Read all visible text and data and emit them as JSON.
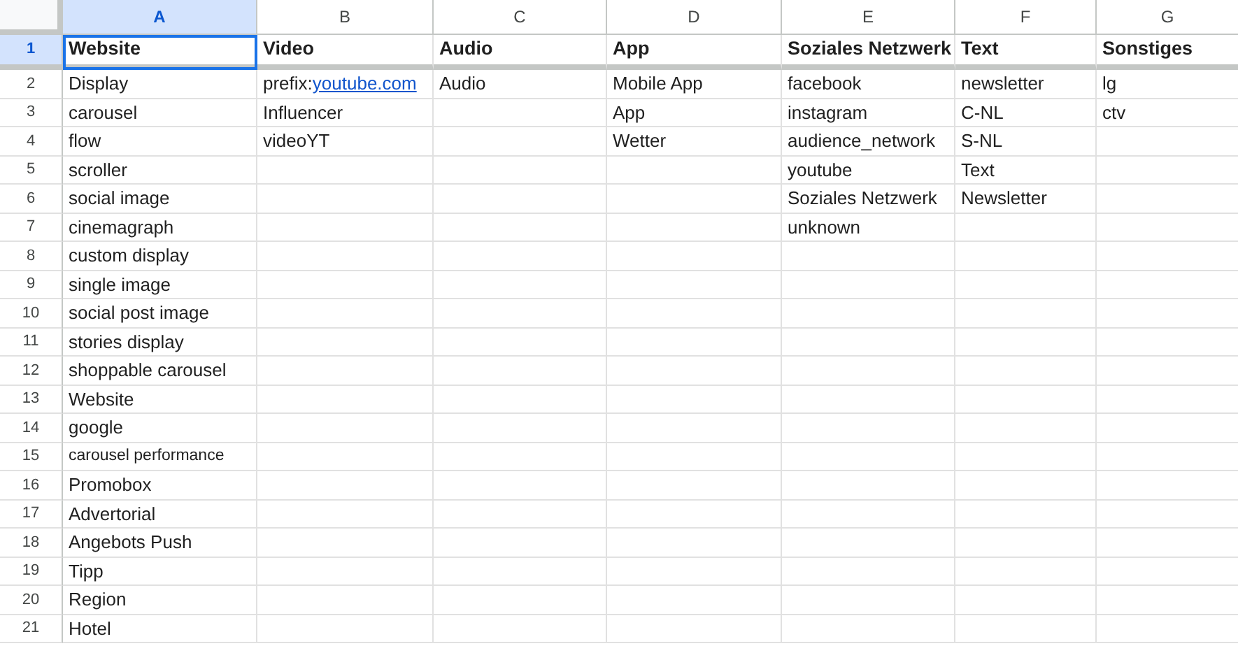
{
  "columns": [
    {
      "label": "A",
      "selected": true
    },
    {
      "label": "B",
      "selected": false
    },
    {
      "label": "C",
      "selected": false
    },
    {
      "label": "D",
      "selected": false
    },
    {
      "label": "E",
      "selected": false
    },
    {
      "label": "F",
      "selected": false
    },
    {
      "label": "G",
      "selected": false
    }
  ],
  "rows": [
    {
      "number": "1",
      "selected": true,
      "bold": true,
      "frozen": true,
      "cells": [
        "Website",
        "Video",
        "Audio",
        "App",
        "Soziales Netzwerk",
        "Text",
        "Sonstiges"
      ]
    },
    {
      "number": "2",
      "selected": false,
      "cells": [
        "Display",
        {
          "text": "prefix:",
          "link": "youtube.com"
        },
        "Audio",
        "Mobile App",
        "facebook",
        "newsletter",
        "lg"
      ]
    },
    {
      "number": "3",
      "selected": false,
      "cells": [
        "carousel",
        "Influencer",
        null,
        "App",
        "instagram",
        "C-NL",
        "ctv"
      ]
    },
    {
      "number": "4",
      "selected": false,
      "cells": [
        "flow",
        "videoYT",
        null,
        "Wetter",
        "audience_network",
        "S-NL",
        null
      ]
    },
    {
      "number": "5",
      "selected": false,
      "cells": [
        "scroller",
        null,
        null,
        null,
        "youtube",
        "Text",
        null
      ]
    },
    {
      "number": "6",
      "selected": false,
      "cells": [
        "social image",
        null,
        null,
        null,
        "Soziales Netzwerk",
        "Newsletter",
        null
      ]
    },
    {
      "number": "7",
      "selected": false,
      "cells": [
        "cinemagraph",
        null,
        null,
        null,
        "unknown",
        null,
        null
      ]
    },
    {
      "number": "8",
      "selected": false,
      "cells": [
        "custom display",
        null,
        null,
        null,
        null,
        null,
        null
      ]
    },
    {
      "number": "9",
      "selected": false,
      "cells": [
        "single image",
        null,
        null,
        null,
        null,
        null,
        null
      ]
    },
    {
      "number": "10",
      "selected": false,
      "cells": [
        "social post image",
        null,
        null,
        null,
        null,
        null,
        null
      ]
    },
    {
      "number": "11",
      "selected": false,
      "cells": [
        "stories display",
        null,
        null,
        null,
        null,
        null,
        null
      ]
    },
    {
      "number": "12",
      "selected": false,
      "cells": [
        "shoppable carousel",
        null,
        null,
        null,
        null,
        null,
        null
      ]
    },
    {
      "number": "13",
      "selected": false,
      "cells": [
        "Website",
        null,
        null,
        null,
        null,
        null,
        null
      ]
    },
    {
      "number": "14",
      "selected": false,
      "cells": [
        "google",
        null,
        null,
        null,
        null,
        null,
        null
      ]
    },
    {
      "number": "15",
      "selected": false,
      "cells": [
        {
          "text": "carousel performance",
          "kind": "small"
        },
        null,
        null,
        null,
        null,
        null,
        null
      ]
    },
    {
      "number": "16",
      "selected": false,
      "cells": [
        "Promobox",
        null,
        null,
        null,
        null,
        null,
        null
      ]
    },
    {
      "number": "17",
      "selected": false,
      "cells": [
        "Advertorial",
        null,
        null,
        null,
        null,
        null,
        null
      ]
    },
    {
      "number": "18",
      "selected": false,
      "cells": [
        "Angebots Push",
        null,
        null,
        null,
        null,
        null,
        null
      ]
    },
    {
      "number": "19",
      "selected": false,
      "cells": [
        "Tipp",
        null,
        null,
        null,
        null,
        null,
        null
      ]
    },
    {
      "number": "20",
      "selected": false,
      "cells": [
        "Region",
        null,
        null,
        null,
        null,
        null,
        null
      ]
    },
    {
      "number": "21",
      "selected": false,
      "cells": [
        "Hotel",
        null,
        null,
        null,
        null,
        null,
        null
      ]
    }
  ]
}
